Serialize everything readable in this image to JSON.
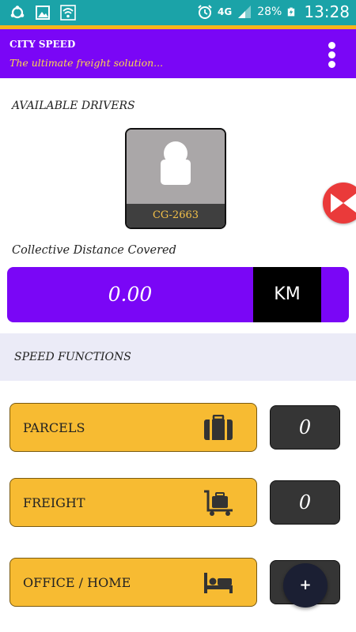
{
  "status_bar": {
    "network": "4G",
    "battery": "28%",
    "time": "13:28",
    "icons": [
      "sync-icon",
      "image-icon",
      "wifi-icon",
      "alarm-icon",
      "signal-icon",
      "battery-charging-icon"
    ]
  },
  "app_bar": {
    "title": "CITY SPEED",
    "subtitle": "The ultimate freight solution...",
    "menu_icon": "overflow-menu-icon"
  },
  "drivers": {
    "heading": "AVAILABLE DRIVERS",
    "items": [
      {
        "plate": "CG-2663",
        "avatar_icon": "person-placeholder-icon"
      }
    ]
  },
  "distance": {
    "heading": "Collective Distance Covered",
    "value": "0.00",
    "unit": "KM"
  },
  "functions": {
    "heading": "SPEED FUNCTIONS",
    "items": [
      {
        "label": "PARCELS",
        "icon": "briefcase-icon",
        "count": "0"
      },
      {
        "label": "FREIGHT",
        "icon": "luggage-trolley-icon",
        "count": "0"
      },
      {
        "label": "OFFICE / HOME",
        "icon": "bed-icon",
        "count": ""
      }
    ]
  },
  "fab": {
    "label": "+"
  },
  "colors": {
    "status_bar": "#1ba3a8",
    "stripe": "#f7b41b",
    "primary": "#7a06f6",
    "subtitle": "#ffd94a",
    "accent_button": "#f7bb32",
    "count_box": "#353535",
    "fab": "#1b1f33",
    "side_fab": "#ea3a3a"
  }
}
